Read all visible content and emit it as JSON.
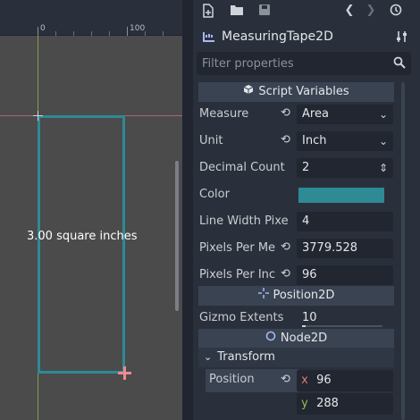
{
  "viewport": {
    "ruler_labels": [
      "0",
      "100"
    ],
    "measure_label": "3.00 square inches",
    "rect_color": "#2e8a95"
  },
  "toolbar": {
    "icons": [
      "new-script-icon",
      "open-folder-icon",
      "save-icon",
      "history-back-icon",
      "history-forward-icon",
      "history-list-icon"
    ]
  },
  "node": {
    "name": "MeasuringTape2D",
    "icon": "measuring-tape-icon",
    "tools_icon": "object-tools-icon"
  },
  "filter": {
    "placeholder": "Filter properties"
  },
  "sections": {
    "script_variables": "Script Variables",
    "position2d": "Position2D",
    "node2d": "Node2D"
  },
  "props": {
    "measure": {
      "label": "Measure",
      "value": "Area"
    },
    "unit": {
      "label": "Unit",
      "value": "Inch"
    },
    "decimal_count": {
      "label": "Decimal Count",
      "value": "2"
    },
    "color": {
      "label": "Color",
      "value": "#2e8a95"
    },
    "line_width": {
      "label": "Line Width Pixe",
      "value": "4"
    },
    "pixels_per_meter": {
      "label": "Pixels Per Me",
      "value": "3779.528"
    },
    "pixels_per_inch": {
      "label": "Pixels Per Inc",
      "value": "96"
    },
    "gizmo_extents": {
      "label": "Gizmo Extents",
      "value": "10"
    }
  },
  "transform": {
    "label": "Transform",
    "position_label": "Position",
    "x_axis": "x",
    "x_value": "96",
    "y_axis": "y",
    "y_value": "288"
  }
}
